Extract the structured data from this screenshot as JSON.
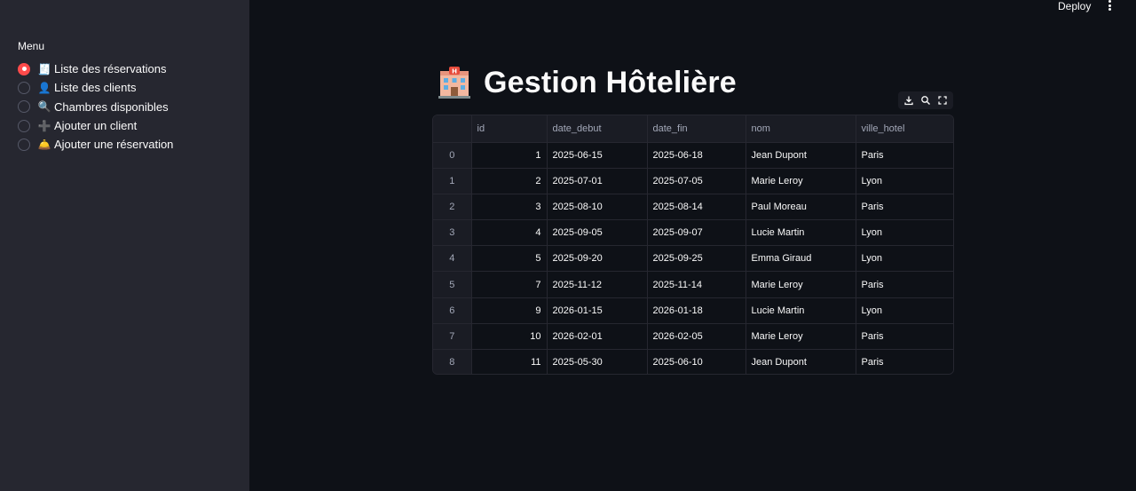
{
  "header": {
    "deploy_label": "Deploy"
  },
  "sidebar": {
    "menu_label": "Menu",
    "items": [
      {
        "emoji": "🧾",
        "label": "Liste des réservations",
        "selected": true
      },
      {
        "emoji": "👤",
        "label": "Liste des clients",
        "selected": false
      },
      {
        "emoji": "🔍",
        "label": "Chambres disponibles",
        "selected": false
      },
      {
        "emoji": "➕",
        "label": "Ajouter un client",
        "selected": false
      },
      {
        "emoji": "🛎️",
        "label": "Ajouter une réservation",
        "selected": false
      }
    ]
  },
  "main": {
    "title": "Gestion Hôtelière",
    "title_icon": "hotel-icon",
    "toolbar": [
      "download-icon",
      "search-icon",
      "fullscreen-icon"
    ],
    "table": {
      "columns": [
        "",
        "id",
        "date_debut",
        "date_fin",
        "nom",
        "ville_hotel"
      ],
      "rows": [
        [
          "0",
          "1",
          "2025-06-15",
          "2025-06-18",
          "Jean Dupont",
          "Paris"
        ],
        [
          "1",
          "2",
          "2025-07-01",
          "2025-07-05",
          "Marie Leroy",
          "Lyon"
        ],
        [
          "2",
          "3",
          "2025-08-10",
          "2025-08-14",
          "Paul Moreau",
          "Paris"
        ],
        [
          "3",
          "4",
          "2025-09-05",
          "2025-09-07",
          "Lucie Martin",
          "Lyon"
        ],
        [
          "4",
          "5",
          "2025-09-20",
          "2025-09-25",
          "Emma Giraud",
          "Lyon"
        ],
        [
          "5",
          "7",
          "2025-11-12",
          "2025-11-14",
          "Marie Leroy",
          "Paris"
        ],
        [
          "6",
          "9",
          "2026-01-15",
          "2026-01-18",
          "Lucie Martin",
          "Lyon"
        ],
        [
          "7",
          "10",
          "2026-02-01",
          "2026-02-05",
          "Marie Leroy",
          "Paris"
        ],
        [
          "8",
          "11",
          "2025-05-30",
          "2025-06-10",
          "Jean Dupont",
          "Paris"
        ]
      ]
    }
  },
  "colors": {
    "background": "#0e1117",
    "sidebar": "#262730",
    "accent": "#ff4b4b",
    "text": "#fafafa",
    "muted": "#a3a8b8"
  }
}
